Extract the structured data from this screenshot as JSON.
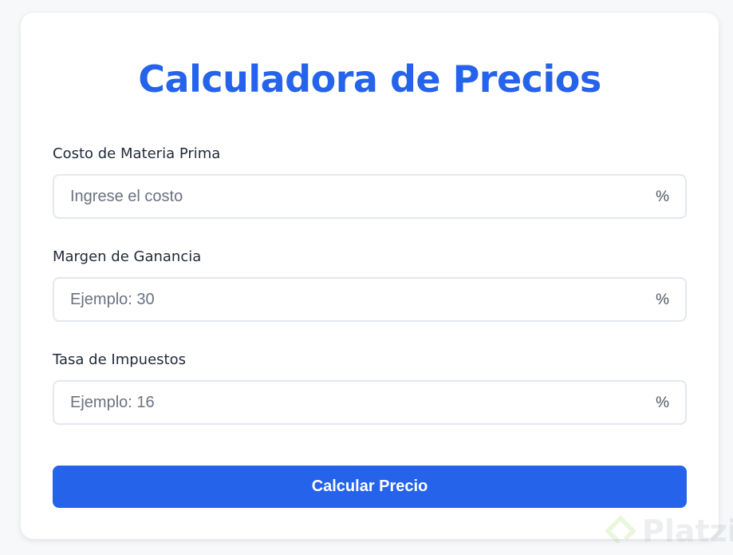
{
  "title": "Calculadora de Precios",
  "colors": {
    "accent": "#2563eb",
    "background": "#f7f8fa",
    "card": "#ffffff",
    "input_border": "#e3e8ee"
  },
  "fields": [
    {
      "label": "Costo de Materia Prima",
      "value": "",
      "placeholder": "Ingrese el costo",
      "suffix": "%"
    },
    {
      "label": "Margen de Ganancia",
      "value": "",
      "placeholder": "Ejemplo: 30",
      "suffix": "%"
    },
    {
      "label": "Tasa de Impuestos",
      "value": "",
      "placeholder": "Ejemplo: 16",
      "suffix": "%"
    }
  ],
  "submit_label": "Calcular Precio",
  "watermark": {
    "text": "Platzi",
    "icon": "platzi-logo-icon"
  }
}
